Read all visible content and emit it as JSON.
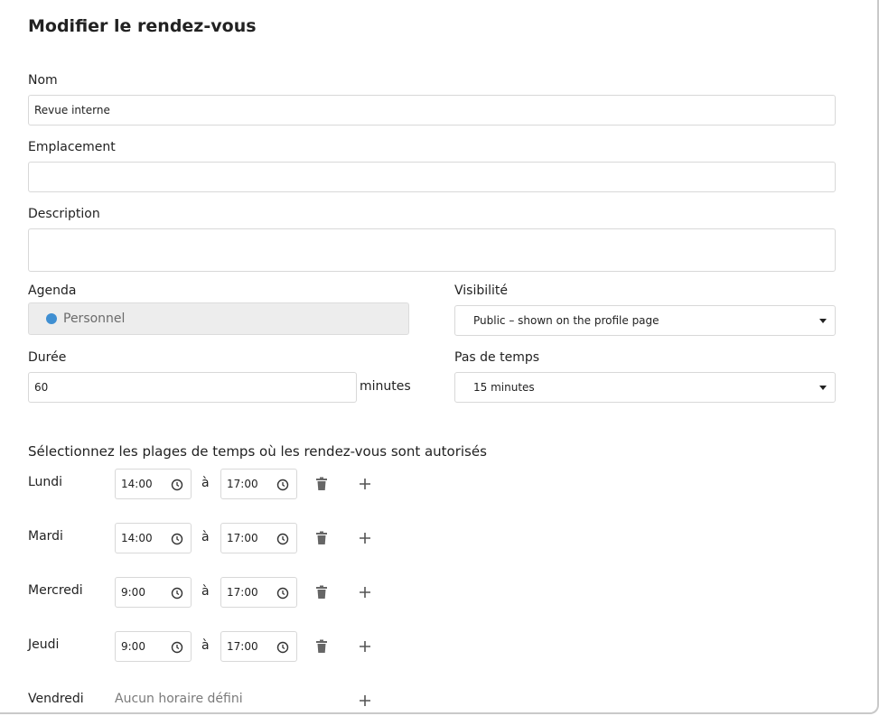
{
  "dialog": {
    "title": "Modifier le rendez-vous"
  },
  "form": {
    "name": {
      "label": "Nom",
      "value": "Revue interne"
    },
    "location": {
      "label": "Emplacement",
      "value": ""
    },
    "description": {
      "label": "Description",
      "value": ""
    },
    "calendar": {
      "label": "Agenda",
      "value": "Personnel",
      "dot_color": "#3f8fd2"
    },
    "visibility": {
      "label": "Visibilité",
      "value": "Public – shown on the profile page"
    },
    "duration": {
      "label": "Durée",
      "value": "60",
      "unit": "minutes"
    },
    "time_step": {
      "label": "Pas de temps",
      "value": "15 minutes"
    }
  },
  "schedule": {
    "title": "Sélectionnez les plages de temps où les rendez-vous sont autorisés",
    "separator": "à",
    "empty_text": "Aucun horaire défini",
    "days": [
      {
        "day": "Lundi",
        "start": "14:00",
        "end": "17:00"
      },
      {
        "day": "Mardi",
        "start": "14:00",
        "end": "17:00"
      },
      {
        "day": "Mercredi",
        "start": "9:00",
        "end": "17:00"
      },
      {
        "day": "Jeudi",
        "start": "9:00",
        "end": "17:00"
      },
      {
        "day": "Vendredi"
      }
    ]
  },
  "icons": {
    "clock": "clock-icon",
    "trash": "trash-icon",
    "plus": "plus-icon",
    "caret": "caret-down-icon"
  }
}
